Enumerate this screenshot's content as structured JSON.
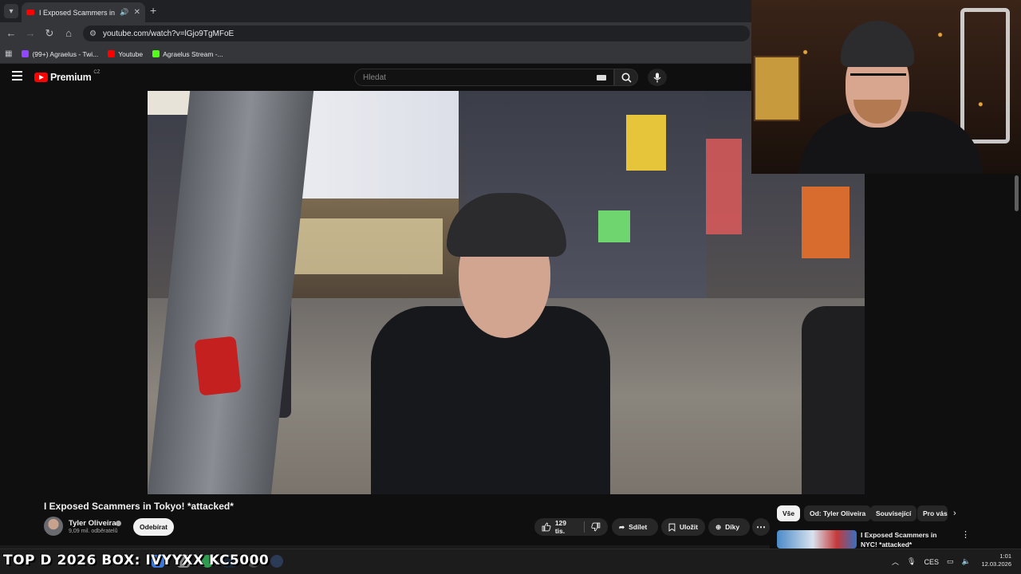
{
  "browser": {
    "tab": {
      "title": "I Exposed Scammers in Tokyo! *attacked*",
      "audio_icon": "speaker-icon",
      "close": "✕"
    },
    "new_tab": "+",
    "url": "youtube.com/watch?v=lGjo9TgMFoE",
    "bookmarks": [
      {
        "label": "(99+) Agraelus - Twi...",
        "color": "#9146ff"
      },
      {
        "label": "Youtube",
        "color": "#ff0000"
      },
      {
        "label": "Agraelus Stream -...",
        "color": "#53fc18"
      }
    ]
  },
  "youtube": {
    "logo_text": "Premium",
    "region": "CZ",
    "search_placeholder": "Hledat",
    "video": {
      "title": "I Exposed Scammers in Tokyo! *attacked*",
      "channel": "Tyler Oliveira",
      "subscribers": "9,09 mil. odběratelů",
      "subscribe_label": "Odebírat",
      "likes": "129 tis.",
      "share_label": "Sdílet",
      "save_label": "Uložit",
      "thanks_label": "Díky"
    },
    "chips": [
      "Vše",
      "Od: Tyler Oliveira",
      "Související",
      "Pro vás"
    ],
    "recommendation": {
      "title": "I Exposed Scammers in NYC! *attacked*"
    }
  },
  "stream_overlay": {
    "promo_text": "TOP D 2026 BOX: IVYYXX KC5000"
  },
  "taskbar": {
    "language": "CES",
    "time": "1:01",
    "date": "12.03.2026"
  },
  "colors": {
    "accent": "#ff0000",
    "background": "#0f0f0f",
    "chip_active": "#f1f1f1"
  }
}
